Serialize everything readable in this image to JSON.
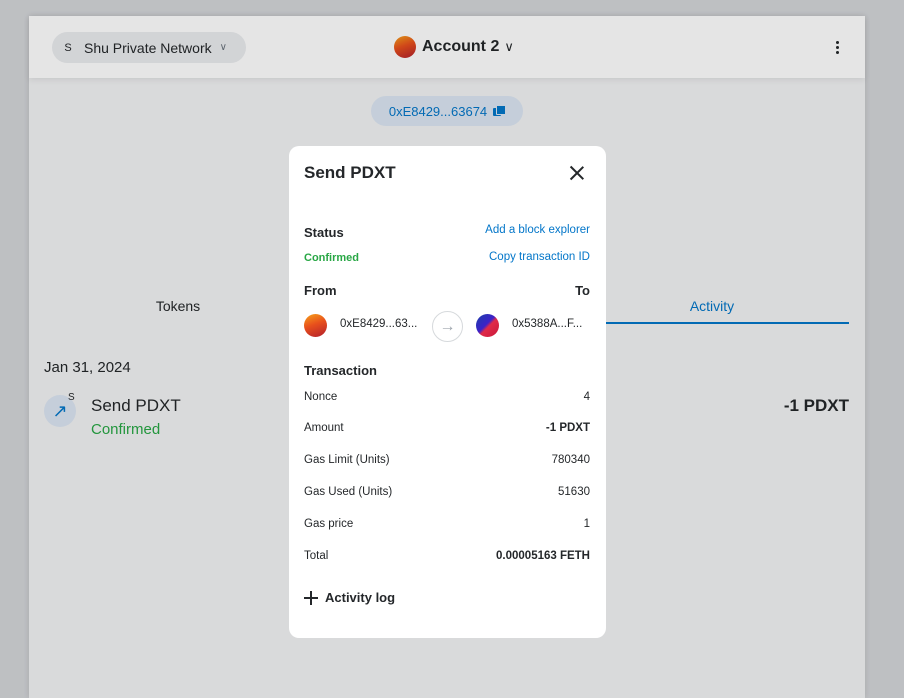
{
  "header": {
    "network": {
      "avatar_letter": "S",
      "label": "Shu Private Network"
    },
    "account": {
      "name": "Account 2"
    }
  },
  "wallet": {
    "address_short": "0xE8429...63674"
  },
  "tabs": [
    {
      "label": "Tokens"
    },
    {
      "label": "Activity"
    }
  ],
  "activity": {
    "date": "Jan 31, 2024",
    "item": {
      "badge": "S",
      "title": "Send PDXT",
      "status": "Confirmed",
      "amount": "-1 PDXT"
    }
  },
  "modal": {
    "title": "Send PDXT",
    "status_label": "Status",
    "status_value": "Confirmed",
    "add_explorer_link": "Add a block explorer",
    "copy_tx_link": "Copy transaction ID",
    "from_label": "From",
    "to_label": "To",
    "from_address": "0xE8429...63...",
    "to_address": "0x5388A...F...",
    "transaction_label": "Transaction",
    "rows": [
      {
        "label": "Nonce",
        "value": "4"
      },
      {
        "label": "Amount",
        "value": "-1 PDXT"
      },
      {
        "label": "Gas Limit (Units)",
        "value": "780340"
      },
      {
        "label": "Gas Used (Units)",
        "value": "51630"
      },
      {
        "label": "Gas price",
        "value": "1"
      },
      {
        "label": "Total",
        "value": "0.00005163 FETH"
      }
    ],
    "activity_log_label": "Activity log"
  },
  "colors": {
    "accent": "#0376c9",
    "success": "#28a745",
    "text": "#24272a"
  }
}
